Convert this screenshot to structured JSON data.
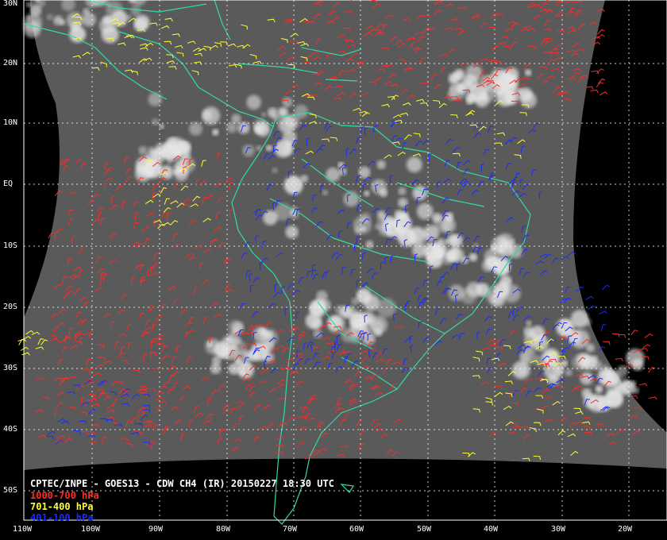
{
  "caption": {
    "title": "CPTEC/INPE - GOES13 - CDW CH4 (IR) 20150227 18:30 UTC",
    "legend": [
      {
        "label": "1000-700 hPa",
        "color": "#ff2a2a"
      },
      {
        "label": "701-400 hPa",
        "color": "#ffff33"
      },
      {
        "label": "401-100 hPa",
        "color": "#1a2cff"
      }
    ]
  },
  "lat_labels": [
    "30N",
    "20N",
    "10N",
    "EQ",
    "10S",
    "20S",
    "30S",
    "40S",
    "50S"
  ],
  "lon_labels": [
    "110W",
    "100W",
    "90W",
    "80W",
    "70W",
    "60W",
    "50W",
    "40W",
    "30W",
    "20W"
  ],
  "colors": {
    "background": "#000000",
    "coastline": "#33d9a6",
    "grid": "#ffffff",
    "cloud_bright": "#e6e6e6",
    "surface_gray": "#5a5a5a"
  }
}
